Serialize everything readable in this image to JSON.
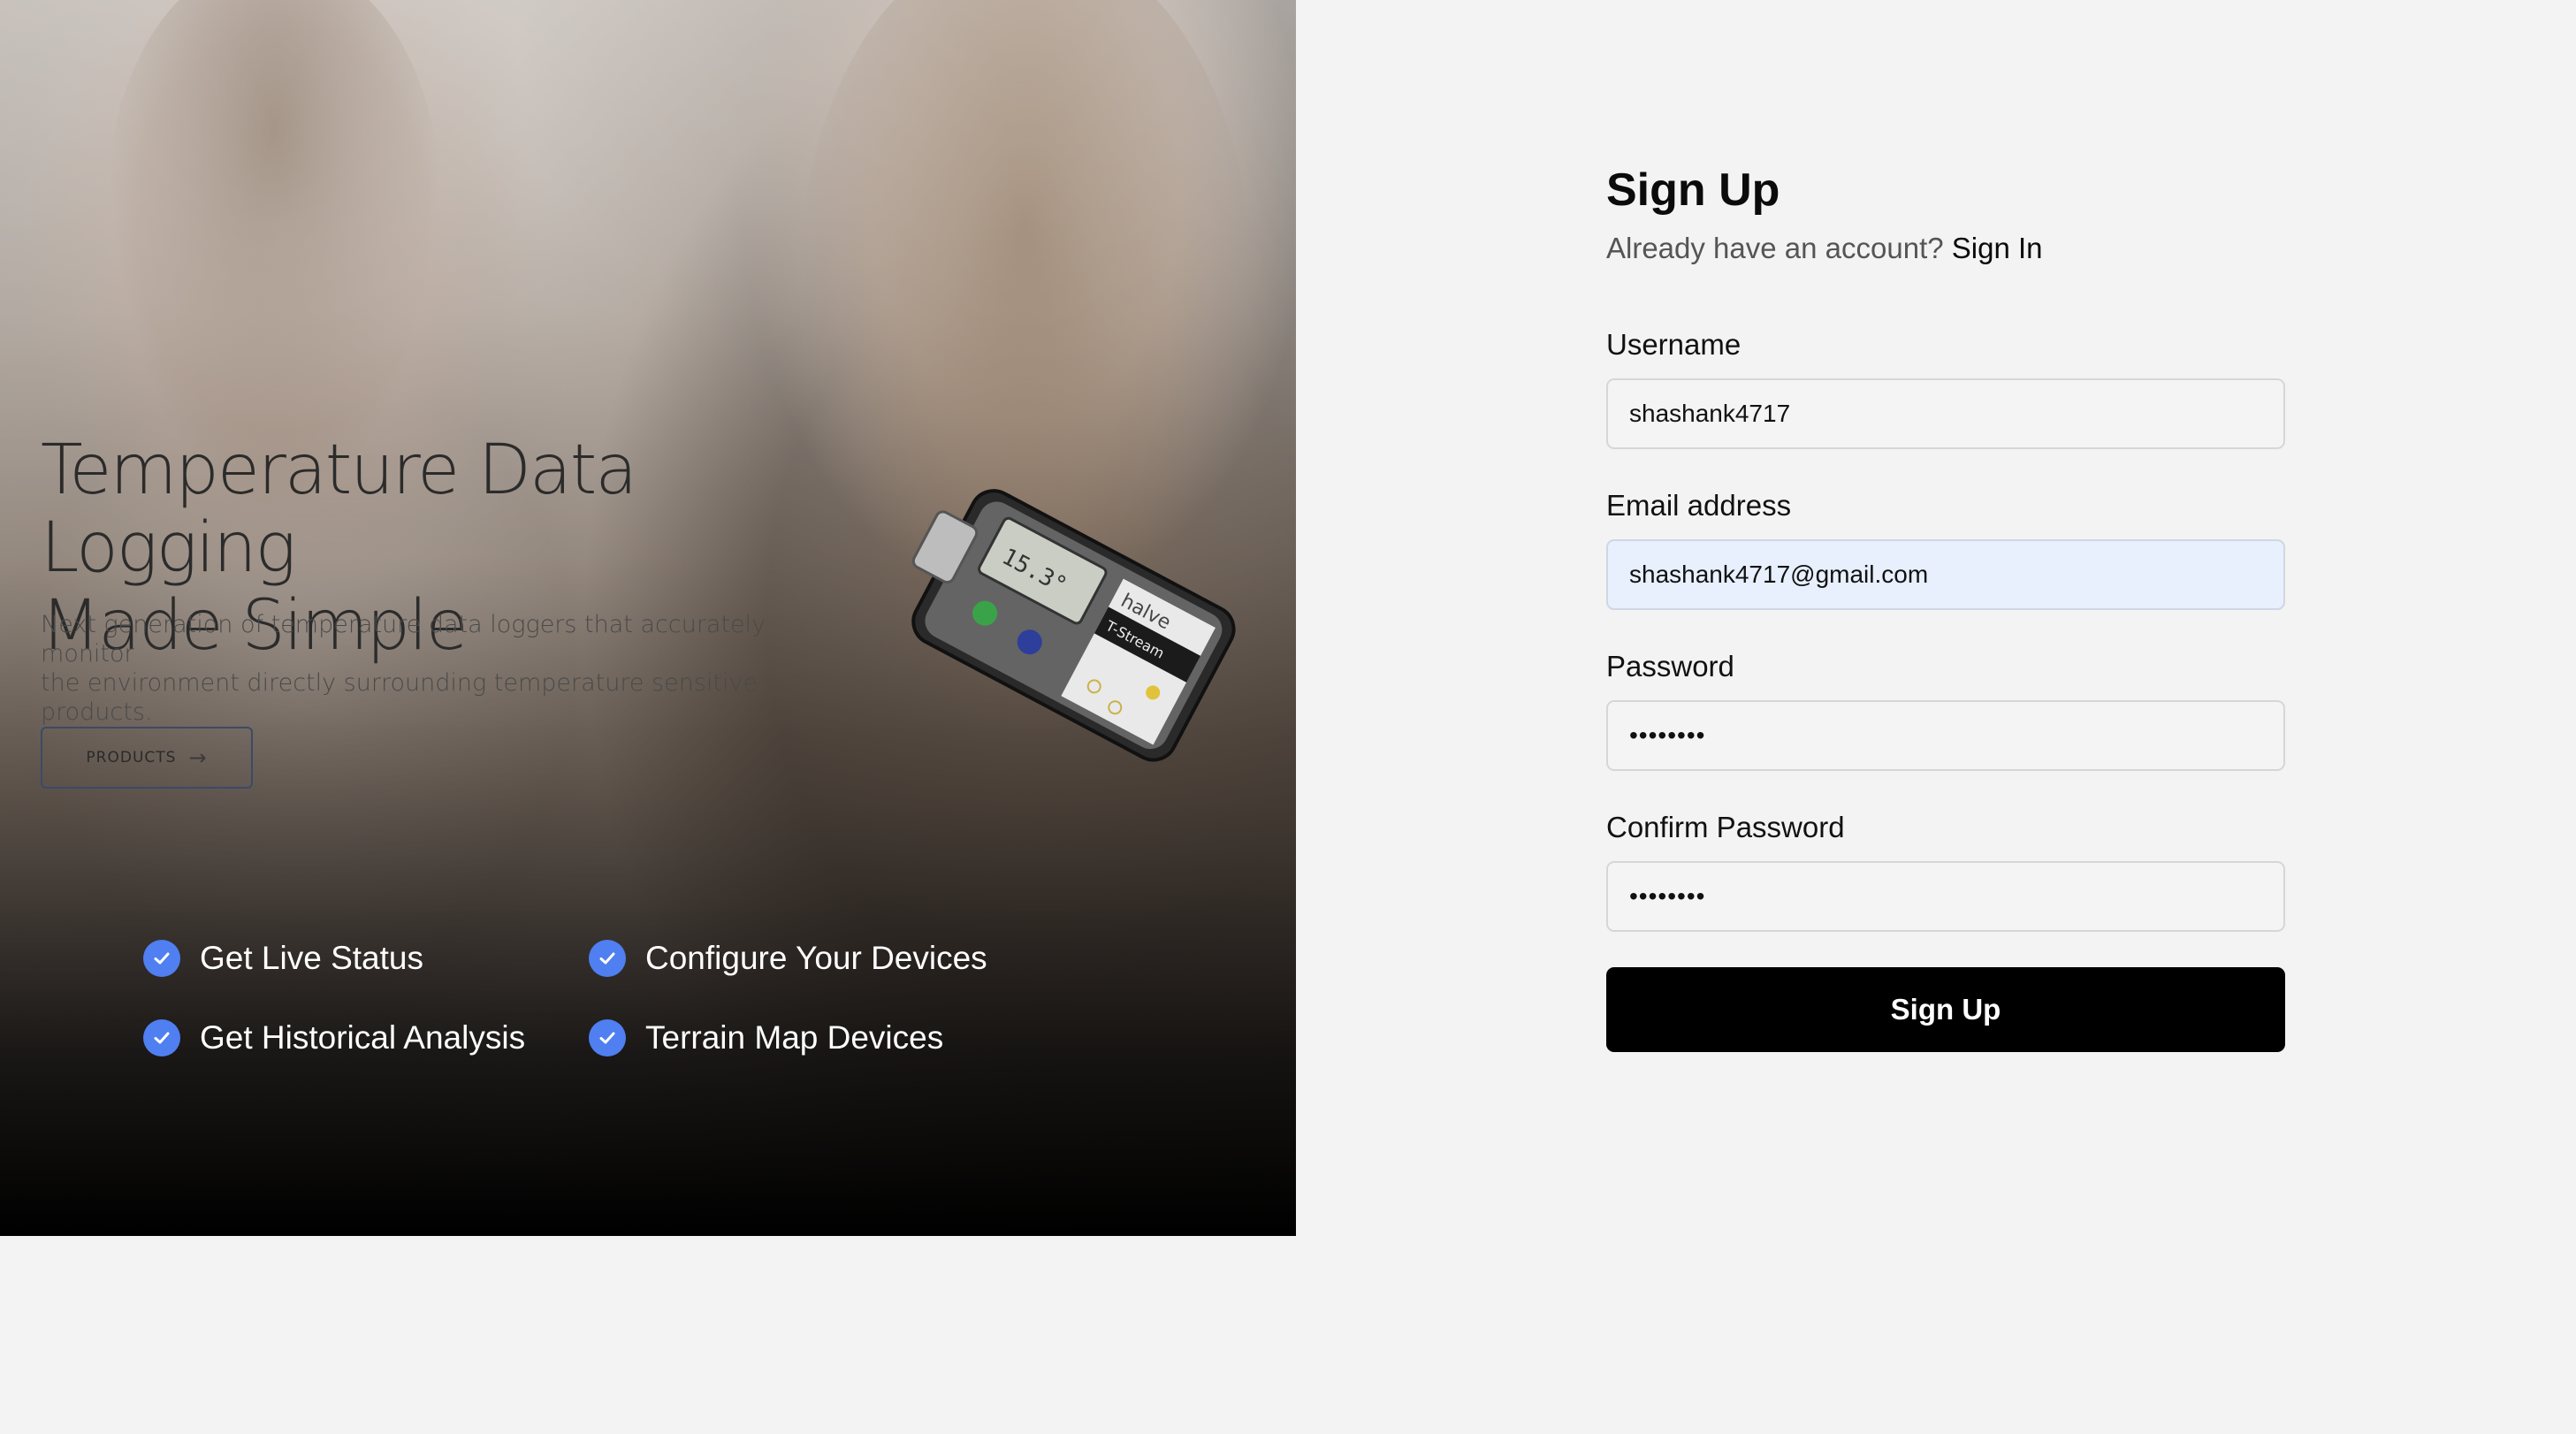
{
  "hero": {
    "title_line1": "Temperature Data Logging",
    "title_line2": "Made Simple",
    "subtitle_line1": "Next generation of temperature data loggers that accurately monitor",
    "subtitle_line2": "the environment directly surrounding temperature sensitive products.",
    "products_label": "PRODUCTS",
    "products_arrow": "→",
    "device_brand": "halve",
    "device_model": "T-Stream",
    "device_reading": "15.3°"
  },
  "features": [
    {
      "label": "Get Live Status",
      "icon": "check-circle-icon"
    },
    {
      "label": "Configure Your Devices",
      "icon": "check-circle-icon"
    },
    {
      "label": "Get Historical Analysis",
      "icon": "check-circle-icon"
    },
    {
      "label": "Terrain Map Devices",
      "icon": "check-circle-icon"
    }
  ],
  "form": {
    "title": "Sign Up",
    "account_prompt": "Already have an account?",
    "signin_label": "Sign In",
    "username_label": "Username",
    "username_value": "shashank4717",
    "email_label": "Email address",
    "email_value": "shashank4717@gmail.com",
    "password_label": "Password",
    "password_value": "password",
    "confirm_label": "Confirm Password",
    "confirm_value": "password",
    "submit_label": "Sign Up"
  },
  "colors": {
    "accent": "#4f7ff0",
    "autofill_bg": "#e8f0fe",
    "button_bg": "#000000",
    "page_bg": "#f3f3f3"
  }
}
